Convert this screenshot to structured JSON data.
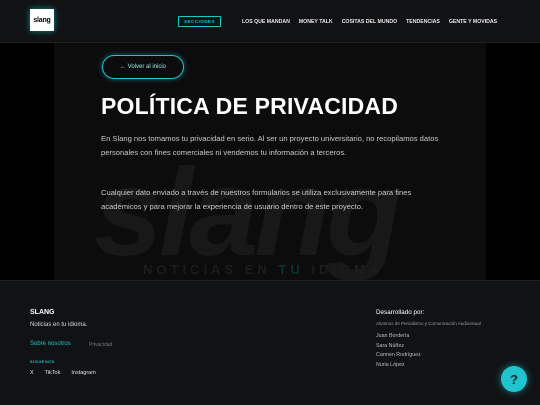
{
  "header": {
    "logo_text": "slang",
    "sections_label": "SECCIONES",
    "nav": [
      "LOS QUE MANDAN",
      "MONEY TALK",
      "COSITAS DEL MUNDO",
      "TENDENCIAS",
      "GENTE Y MOVIDAS"
    ]
  },
  "main": {
    "back_label": "← Volver al inicio",
    "title": "POLÍTICA DE PRIVACIDAD",
    "paragraphs": [
      "En Slang nos tomamos tu privacidad en serio. Al ser un proyecto universitario, no recopilamos datos personales con fines comerciales ni vendemos tu información a terceros.",
      "Cualquier dato enviado a través de nuestros formularios se utiliza exclusivamente para fines académicos y para mejorar la experiencia de usuario dentro de este proyecto."
    ],
    "watermark": {
      "word": "slang",
      "tagline_before": "NOTICIAS EN ",
      "tagline_highlight": "TU",
      "tagline_after": " IDIOMA"
    }
  },
  "footer": {
    "brand": "SLANG",
    "tagline": "Noticias en tu idioma.",
    "about_link": "Sobre nosotros",
    "privacy_link": "Privacidad",
    "follow_label": "SÍGUENOS",
    "socials": [
      "X",
      "TikTok",
      "Instagram"
    ],
    "dev_title": "Desarrollado por:",
    "dev_subtitle": "Alumnos de Periodismo y Comunicación Audiovisual",
    "developers": [
      "Juan Bordería",
      "Sara Núñez",
      "Carmen Rodríguez",
      "Nuria López"
    ]
  },
  "help_button": {
    "label": "?"
  },
  "colors": {
    "accent": "#20c4cc",
    "background": "#000000",
    "panel": "#0c0c0d",
    "header_footer": "#111214"
  }
}
